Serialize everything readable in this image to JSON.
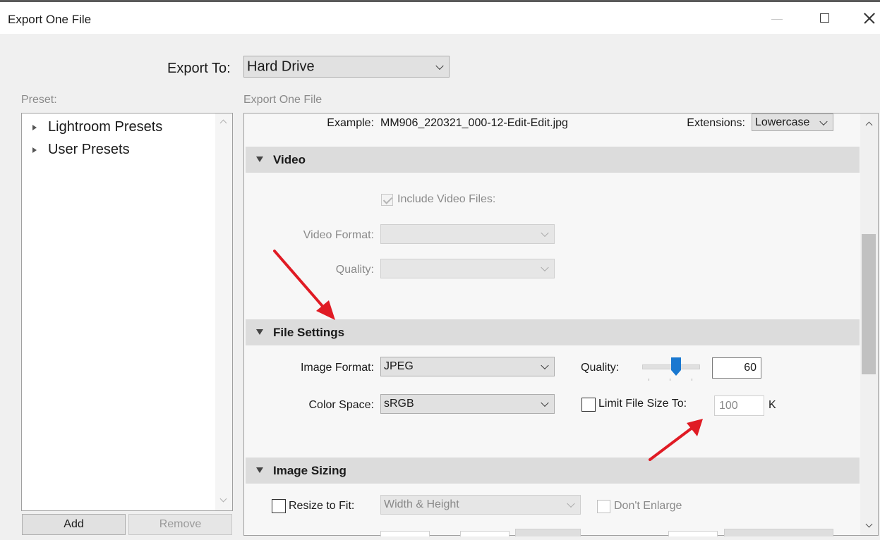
{
  "window": {
    "title": "Export One File"
  },
  "export_to": {
    "label": "Export To:",
    "value": "Hard Drive"
  },
  "preset": {
    "label": "Preset:",
    "items": [
      {
        "label": "Lightroom Presets"
      },
      {
        "label": "User Presets"
      }
    ],
    "add_label": "Add",
    "remove_label": "Remove"
  },
  "settings_header": "Export One File",
  "file_naming": {
    "example_label": "Example:",
    "example_value": "MM906_220321_000-12-Edit-Edit.jpg",
    "extensions_label": "Extensions:",
    "extensions_value": "Lowercase"
  },
  "video": {
    "title": "Video",
    "include_label": "Include Video Files:",
    "include_checked": true,
    "format_label": "Video Format:",
    "format_value": "",
    "quality_label": "Quality:",
    "quality_value": ""
  },
  "file_settings": {
    "title": "File Settings",
    "image_format_label": "Image Format:",
    "image_format_value": "JPEG",
    "quality_label": "Quality:",
    "quality_value": "60",
    "quality_level_percent": 60,
    "color_space_label": "Color Space:",
    "color_space_value": "sRGB",
    "limit_label": "Limit File Size To:",
    "limit_checked": false,
    "limit_value": "100",
    "limit_unit": "K"
  },
  "image_sizing": {
    "title": "Image Sizing",
    "resize_label": "Resize to Fit:",
    "resize_checked": false,
    "resize_mode": "Width & Height",
    "dont_enlarge_label": "Don't Enlarge"
  },
  "colors": {
    "annotation_arrow": "#e01b24",
    "slider_thumb": "#1a78d0",
    "section_bg": "#dcdcdc"
  }
}
